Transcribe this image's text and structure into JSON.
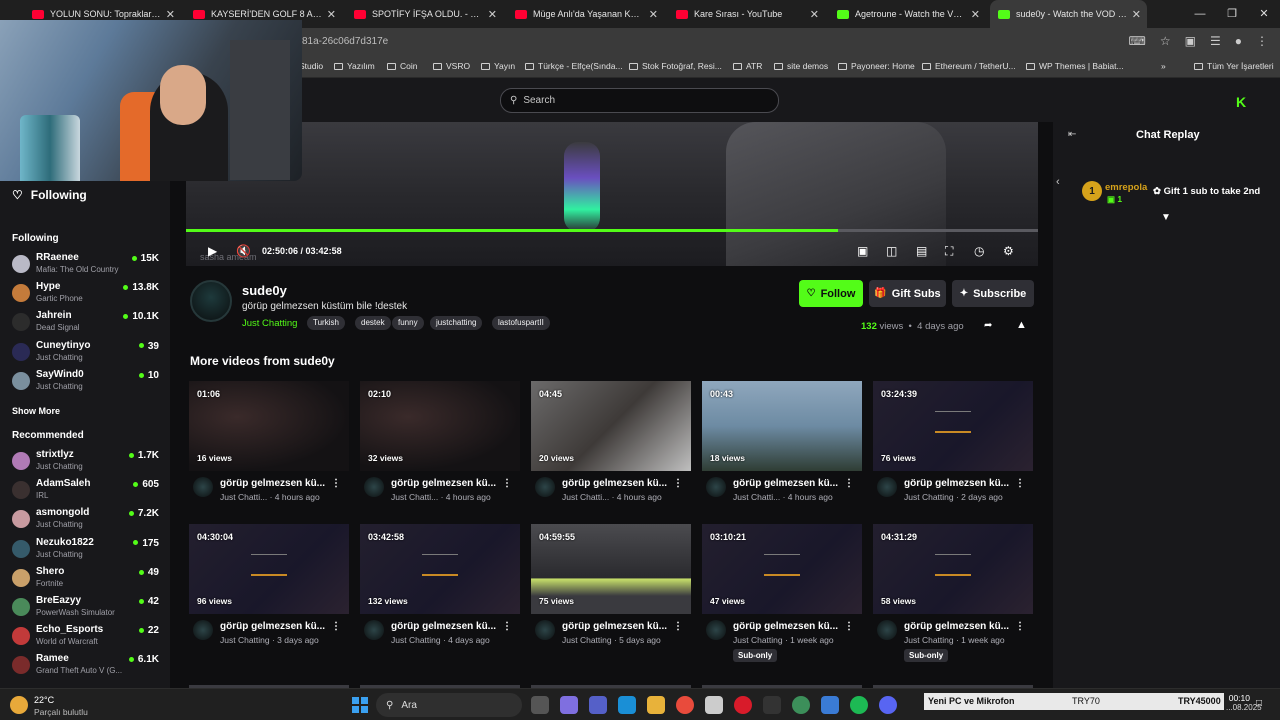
{
  "browser": {
    "tabs": [
      {
        "title": "YOLUN SONU: Toprakları Rusya",
        "color": "#ff0033"
      },
      {
        "title": "KAYSERİ'DEN GOLF 8 ALDIK ! -",
        "color": "#ff0033"
      },
      {
        "title": "SPOTİFY İFŞA OLDU. - YouTube",
        "color": "#ff0033"
      },
      {
        "title": "Müge Anlı'da Yaşanan Korkunç",
        "color": "#ff0033"
      },
      {
        "title": "Kare Sırası - YouTube",
        "color": "#ff0033"
      },
      {
        "title": "Agetroune - Watch the VOD on",
        "color": "#53fc18"
      },
      {
        "title": "sude0y - Watch the VOD on Ki",
        "color": "#53fc18"
      }
    ],
    "url_fragment": "81a-26c06d7d317e",
    "bookmarks": [
      "Studio",
      "Yazılım",
      "Coin",
      "VSRO",
      "Yayın",
      "Türkçe - Elfçe(Sında...",
      "Stok Fotoğraf, Resi...",
      "ATR",
      "site demos",
      "Payoneer: Home",
      "Ethereum / TetherU...",
      "WP Themes | Babiat...",
      "Tüm Yer İşaretleri"
    ]
  },
  "header": {
    "search_placeholder": "Search",
    "logo": "K"
  },
  "sidebar": {
    "following_button": "Following",
    "following_heading": "Following",
    "following": [
      {
        "name": "RRaenee",
        "category": "Mafia: The Old Country",
        "viewers": "15K"
      },
      {
        "name": "Hype",
        "category": "Gartic Phone",
        "viewers": "13.8K"
      },
      {
        "name": "Jahrein",
        "category": "Dead Signal",
        "viewers": "10.1K"
      },
      {
        "name": "Cuneytinyo",
        "category": "Just Chatting",
        "viewers": "39"
      },
      {
        "name": "SayWind0",
        "category": "Just Chatting",
        "viewers": "10"
      }
    ],
    "show_more": "Show More",
    "recommended_heading": "Recommended",
    "recommended": [
      {
        "name": "strixtlyz",
        "category": "Just Chatting",
        "viewers": "1.7K"
      },
      {
        "name": "AdamSaleh",
        "category": "IRL",
        "viewers": "605"
      },
      {
        "name": "asmongold",
        "category": "Just Chatting",
        "viewers": "7.2K"
      },
      {
        "name": "Nezuko1822",
        "category": "Just Chatting",
        "viewers": "175"
      },
      {
        "name": "Shero",
        "category": "Fortnite",
        "viewers": "49"
      },
      {
        "name": "BreEazyy",
        "category": "PowerWash Simulator",
        "viewers": "42"
      },
      {
        "name": "Echo_Esports",
        "category": "World of Warcraft",
        "viewers": "22"
      },
      {
        "name": "Ramee",
        "category": "Grand Theft Auto V (G...",
        "viewers": "6.1K"
      }
    ]
  },
  "player": {
    "current_time": "02:50:06",
    "duration": "03:42:58",
    "progress": 0.765,
    "overlay_text": "sasha ameam"
  },
  "channel": {
    "name": "sude0y",
    "title": "görüp gelmezsen küstüm bile !destek",
    "category": "Just Chatting",
    "tags": [
      "Turkish",
      "destek",
      "funny",
      "justchatting",
      "lastofuspartII"
    ],
    "follow": "Follow",
    "gift_subs": "Gift Subs",
    "subscribe": "Subscribe",
    "views_count": "132",
    "views_label": "views",
    "separator": "•",
    "posted": "4 days ago"
  },
  "more_videos": {
    "heading": "More videos from sude0y",
    "videos": [
      {
        "duration": "01:06",
        "views": "16 views",
        "title": "görüp gelmezsen kü...",
        "sub": "Just Chatti... · 4 hours ago",
        "sub_only": ""
      },
      {
        "duration": "02:10",
        "views": "32 views",
        "title": "görüp gelmezsen kü...",
        "sub": "Just Chatti... · 4 hours ago",
        "sub_only": ""
      },
      {
        "duration": "04:45",
        "views": "20 views",
        "title": "görüp gelmezsen kü...",
        "sub": "Just Chatti... · 4 hours ago",
        "sub_only": ""
      },
      {
        "duration": "00:43",
        "views": "18 views",
        "title": "görüp gelmezsen kü...",
        "sub": "Just Chatti... · 4 hours ago",
        "sub_only": ""
      },
      {
        "duration": "03:24:39",
        "views": "76 views",
        "title": "görüp gelmezsen kü...",
        "sub": "Just Chatting · 2 days ago",
        "sub_only": ""
      },
      {
        "duration": "04:30:04",
        "views": "96 views",
        "title": "görüp gelmezsen kü...",
        "sub": "Just Chatting · 3 days ago",
        "sub_only": ""
      },
      {
        "duration": "03:42:58",
        "views": "132 views",
        "title": "görüp gelmezsen kü...",
        "sub": "Just Chatting · 4 days ago",
        "sub_only": ""
      },
      {
        "duration": "04:59:55",
        "views": "75 views",
        "title": "görüp gelmezsen kü...",
        "sub": "Just Chatting · 5 days ago",
        "sub_only": ""
      },
      {
        "duration": "03:10:21",
        "views": "47 views",
        "title": "görüp gelmezsen kü...",
        "sub": "Just Chatting · 1 week ago",
        "sub_only": "Sub-only"
      },
      {
        "duration": "04:31:29",
        "views": "58 views",
        "title": "görüp gelmezsen kü...",
        "sub": "Just Chatting · 1 week ago",
        "sub_only": "Sub-only"
      }
    ]
  },
  "chat": {
    "title": "Chat Replay",
    "gifter": {
      "rank": "1",
      "name": "emrepola",
      "count": "1"
    },
    "gift_message": "Gift 1 sub to take 2nd"
  },
  "taskbar": {
    "temperature": "22°C",
    "weather": "Parçalı bulutlu",
    "search": "Ara",
    "ticker_text": "Yeni PC ve Mikrofon",
    "ticker_value1": "TRY70",
    "ticker_value2": "TRY45000",
    "time": "00:10",
    "date": "...08.2025"
  }
}
